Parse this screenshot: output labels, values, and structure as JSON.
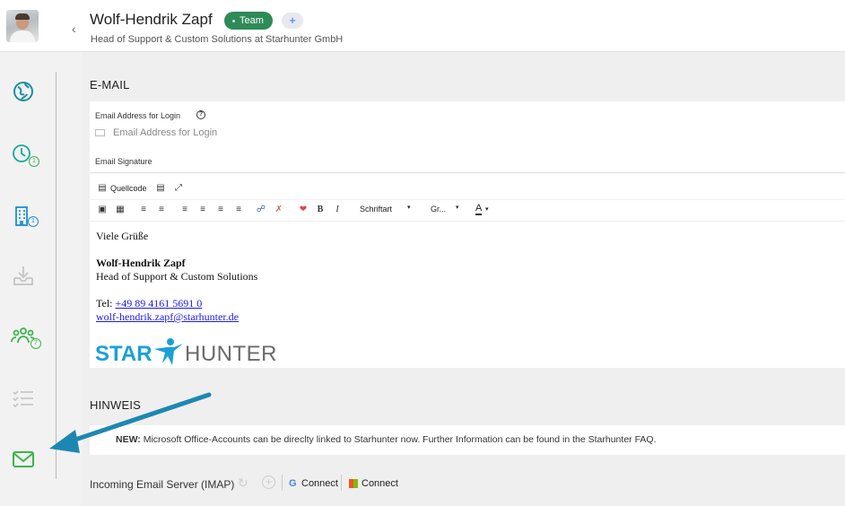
{
  "header": {
    "name": "Wolf-Hendrik Zapf",
    "badge": "Team",
    "add_tag": "+",
    "subtitle": "Head of Support & Custom Solutions at Starhunter GmbH"
  },
  "sidebar": {
    "items": [
      {
        "icon": "globe-icon",
        "badge": ""
      },
      {
        "icon": "clock-icon",
        "badge": "1"
      },
      {
        "icon": "building-icon",
        "badge": "1"
      },
      {
        "icon": "download-tray-icon",
        "badge": ""
      },
      {
        "icon": "people-icon",
        "badge": "7"
      },
      {
        "icon": "checklist-icon",
        "badge": ""
      },
      {
        "icon": "envelope-icon",
        "badge": ""
      }
    ]
  },
  "email": {
    "section_title": "E-MAIL",
    "login_label": "Email Address for Login",
    "login_placeholder": "Email Address for Login",
    "signature_label": "Email Signature"
  },
  "editor": {
    "source_label": "Quellcode",
    "font_label": "Schriftart",
    "size_label": "Gr...",
    "bold": "B",
    "italic": "I",
    "textcolor": "A"
  },
  "signature": {
    "greeting": "Viele Grüße",
    "name": "Wolf-Hendrik Zapf",
    "title": "Head of Support & Custom Solutions",
    "tel_prefix": "Tel: ",
    "tel": "+49 89 4161 5691 0",
    "email": "wolf-hendrik.zapf@starhunter.de",
    "logo_star": "STAR",
    "logo_hunter": "HUNTER"
  },
  "hinweis": {
    "section_title": "HINWEIS",
    "new_label": "NEW:",
    "text": " Microsoft Office-Accounts can be direclty linked to Starhunter now. Further Information can be found in the Starhunter FAQ."
  },
  "imap": {
    "label": "Incoming Email Server (IMAP)",
    "google_connect": "Connect",
    "ms_connect": "Connect"
  },
  "colors": {
    "badge": "#2e8b57",
    "nav_teal": "#1a8fa0",
    "nav_green": "#3cb54a",
    "logo_blue": "#1aa0d8",
    "logo_gray": "#666666"
  }
}
